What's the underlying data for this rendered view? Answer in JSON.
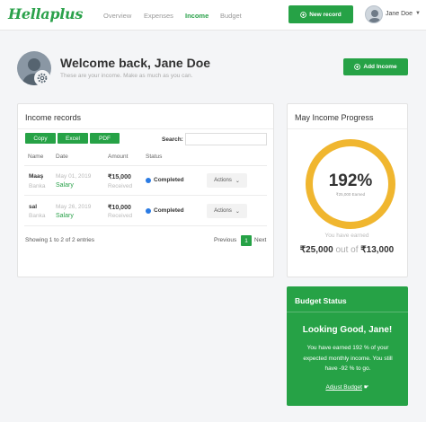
{
  "brand": {
    "logo": "Hellaplus",
    "accent": "#26a246",
    "ring_color": "#f0b62f"
  },
  "nav": {
    "links": [
      "Overview",
      "Expenses",
      "Income",
      "Budget"
    ],
    "active": "Income",
    "new_record": "New record",
    "user": "Jane Doe"
  },
  "header": {
    "welcome": "Welcome back, Jane Doe",
    "subtitle": "These are your income. Make as much as you can.",
    "add_income": "Add Income"
  },
  "records": {
    "title": "Income records",
    "export": [
      "Copy",
      "Excel",
      "PDF"
    ],
    "search_label": "Search:",
    "search_value": "",
    "columns": [
      "Name",
      "Date",
      "Amount",
      "Status"
    ],
    "rows": [
      {
        "name": "Maaş",
        "source": "Banka",
        "date": "May 01, 2019",
        "category": "Salary",
        "amount": "₹15,000",
        "amount_label": "Received",
        "status": "Completed",
        "action": "Actions"
      },
      {
        "name": "sal",
        "source": "Banka",
        "date": "May 26, 2019",
        "category": "Salary",
        "amount": "₹10,000",
        "amount_label": "Received",
        "status": "Completed",
        "action": "Actions"
      }
    ],
    "showing": "Showing 1 to 2 of 2 entries",
    "prev": "Previous",
    "page": "1",
    "next": "Next"
  },
  "progress": {
    "title": "May Income Progress",
    "percent": "192%",
    "earned_caption": "₹25,000 Earned",
    "have_earned": "You have earned",
    "earned": "₹25,000",
    "out_of": "out of",
    "target": "₹13,000"
  },
  "budget": {
    "title": "Budget Status",
    "headline": "Looking Good, Jane!",
    "message": "You have earned 192 % of your expected monthly income. You still have -92 % to go.",
    "link": "Adjust Budget"
  }
}
